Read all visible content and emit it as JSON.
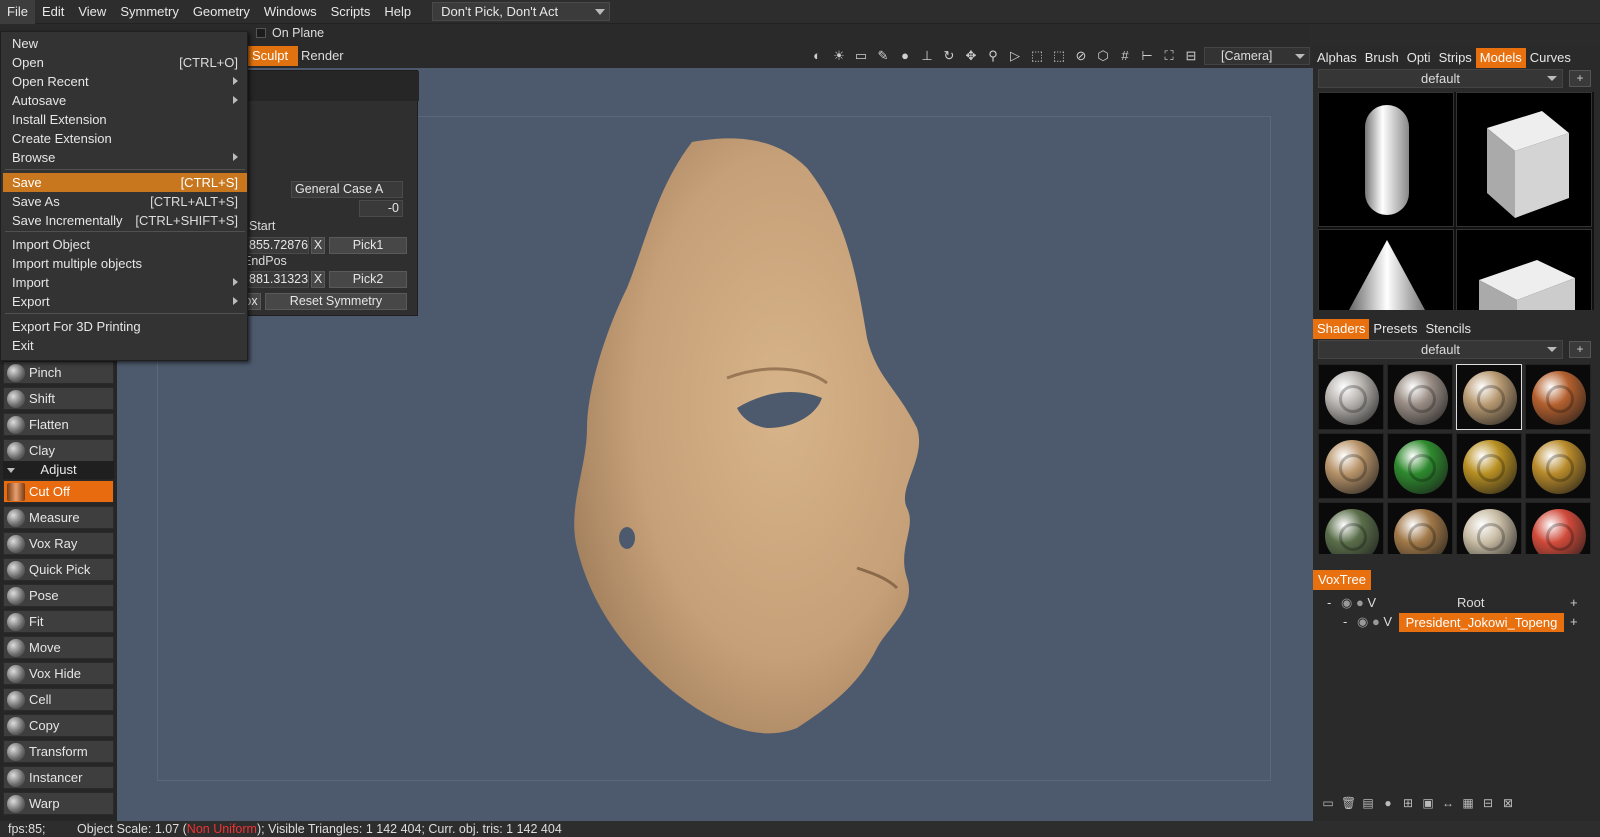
{
  "menubar": {
    "items": [
      "File",
      "Edit",
      "View",
      "Symmetry",
      "Geometry",
      "Windows",
      "Scripts",
      "Help"
    ],
    "preset": "Don't Pick, Don't Act"
  },
  "toolbar": {
    "on_plane": "On Plane",
    "tab_sculpt": "Sculpt",
    "tab_render": "Render",
    "camera": "[Camera]",
    "icons": [
      "contrast-icon",
      "light-icon",
      "image-icon",
      "brush-icon",
      "drop-icon",
      "pin-icon",
      "rotate-icon",
      "move-icon",
      "zoom-icon",
      "play-icon",
      "alt-icon",
      "pen-icon",
      "no-icon",
      "cube-icon",
      "grid-icon",
      "axis-icon",
      "frame-icon",
      "layout-icon"
    ]
  },
  "file_menu": {
    "items": [
      {
        "label": "New",
        "shortcut": ""
      },
      {
        "label": "Open",
        "shortcut": "[CTRL+O]"
      },
      {
        "label": "Open Recent",
        "shortcut": "",
        "submenu": true
      },
      {
        "label": "Autosave",
        "shortcut": "",
        "submenu": true
      },
      {
        "label": "Install Extension",
        "shortcut": ""
      },
      {
        "label": "Create Extension",
        "shortcut": ""
      },
      {
        "label": "Browse",
        "shortcut": "",
        "submenu": true
      },
      {
        "label": "Save",
        "shortcut": "[CTRL+S]",
        "highlight": true
      },
      {
        "label": "Save As",
        "shortcut": "[CTRL+ALT+S]"
      },
      {
        "label": "Save Incrementally",
        "shortcut": "[CTRL+SHIFT+S]"
      },
      {
        "label": "Import Object",
        "shortcut": ""
      },
      {
        "label": "Import multiple objects",
        "shortcut": ""
      },
      {
        "label": "Import",
        "shortcut": "",
        "submenu": true
      },
      {
        "label": "Export",
        "shortcut": "",
        "submenu": true
      },
      {
        "label": "Export For 3D Printing",
        "shortcut": ""
      },
      {
        "label": "Exit",
        "shortcut": ""
      }
    ]
  },
  "symmetry_panel": {
    "case_value": "General Case A",
    "offset_value": "-0",
    "start_label": "Start",
    "start_value": "855.72876",
    "x_label": "X",
    "pick1": "Pick1",
    "endpos_label": "EndPos",
    "endpos_value": "881.31323",
    "pick2": "Pick2",
    "box_label": "ox",
    "reset": "Reset Symmetry"
  },
  "tools": {
    "top_items": [
      "Pinch",
      "Shift",
      "Flatten",
      "Clay"
    ],
    "adjust_header": "Adjust",
    "adjust_items": [
      "Cut Off",
      "Measure",
      "Vox Ray",
      "Quick Pick",
      "Pose",
      "Fit",
      "Move",
      "Vox Hide",
      "Cell",
      "Copy",
      "Transform",
      "Instancer",
      "Warp"
    ],
    "selected": "Cut Off"
  },
  "right_panel": {
    "tabs1": [
      "Alphas",
      "Brush",
      "Opti",
      "Strips",
      "Models",
      "Curves"
    ],
    "tabs1_active": "Models",
    "models_preset": "default",
    "tabs2": [
      "Shaders",
      "Presets",
      "Stencils"
    ],
    "tabs2_active": "Shaders",
    "shaders_preset": "default",
    "shader_colors": [
      "#b8b4b0",
      "#9a8e86",
      "#b89a72",
      "#b4602e",
      "#b8946a",
      "#2e8a2e",
      "#b89022",
      "#b88a2a",
      "#5a6e4a",
      "#a07848",
      "#c8bca4",
      "#d04a3a"
    ],
    "voxtree_tab": "VoxTree",
    "root": "Root",
    "node": "President_Jokowi_Topeng",
    "v_label": "V"
  },
  "status": {
    "fps": "fps:85;",
    "scale_prefix": "Object Scale: 1.07 (",
    "scale_mode": "Non Uniform",
    "rest": "); Visible Triangles: 1 142 404; Curr. obj. tris: 1 142 404"
  }
}
